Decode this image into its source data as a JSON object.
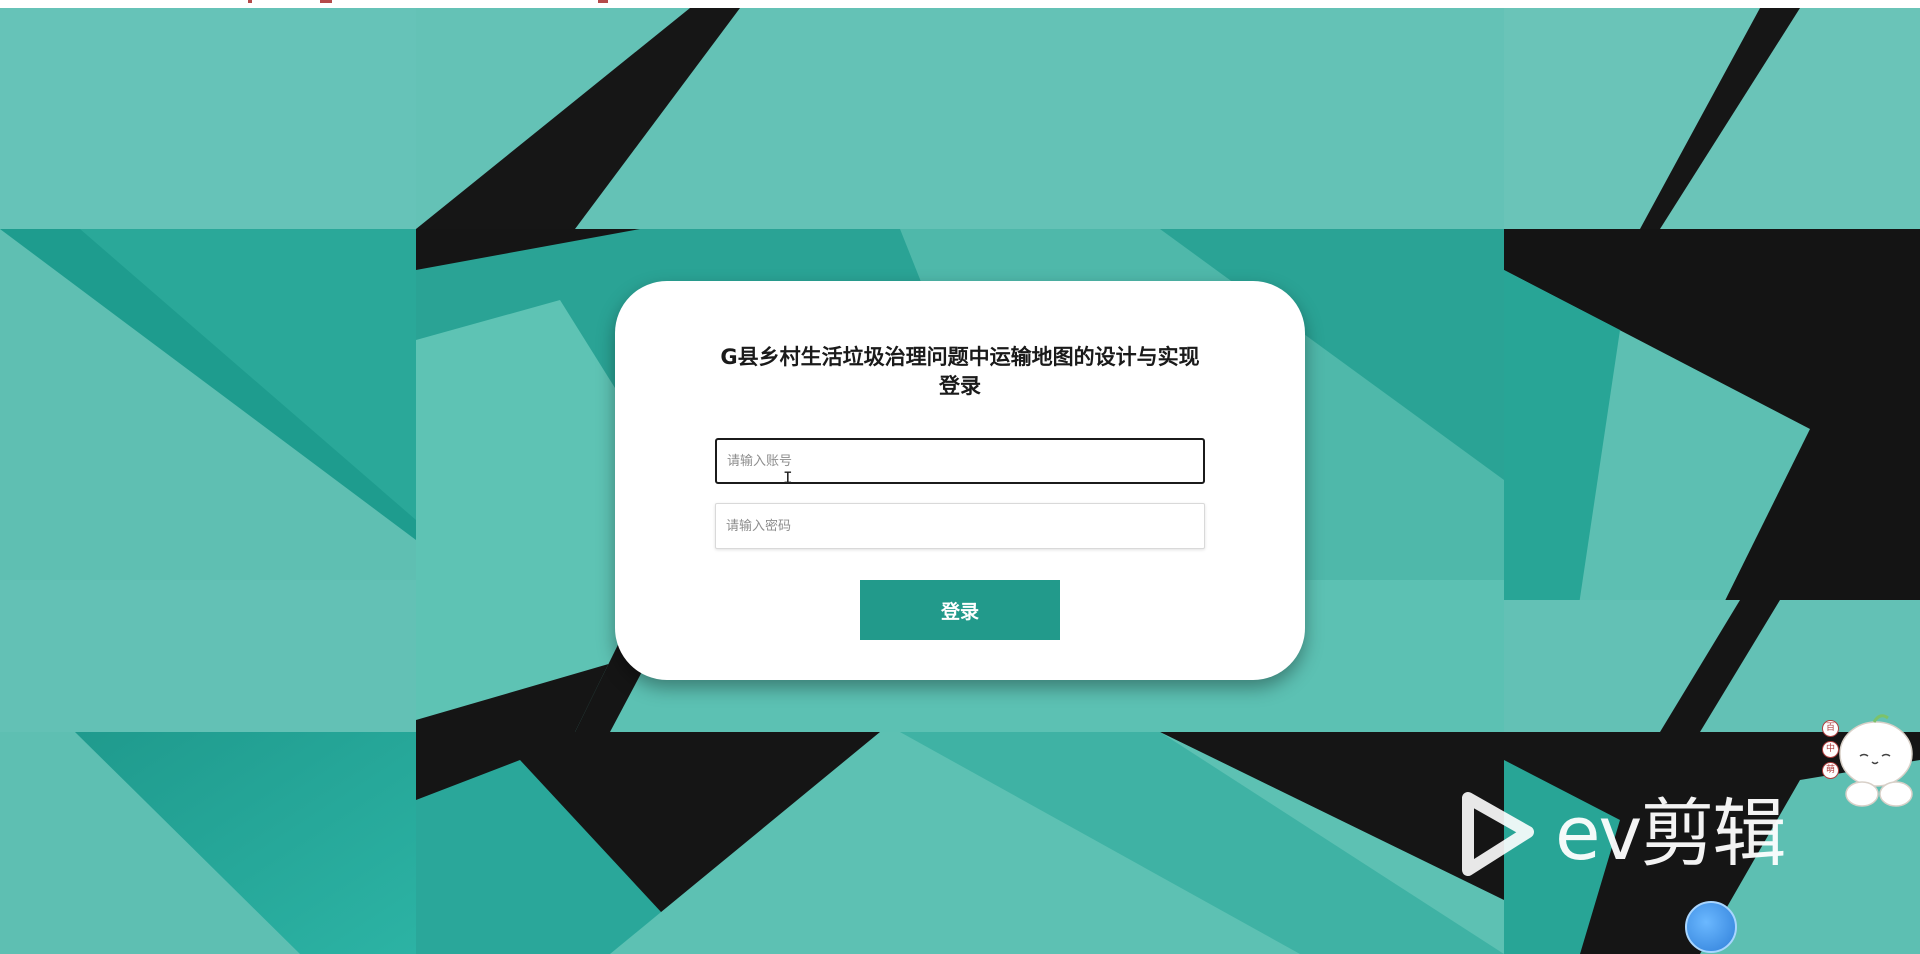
{
  "login": {
    "title": "G县乡村生活垃圾治理问题中运输地图的设计与实现登录",
    "account_placeholder": "请输入账号",
    "password_placeholder": "请输入密码",
    "button_label": "登录"
  },
  "overlay": {
    "watermark_text": "ev剪辑",
    "side_badges": [
      "百",
      "中",
      "萌"
    ]
  },
  "colors": {
    "accent": "#229a8b",
    "background_teal": "#63c0b4",
    "background_dark": "#141414"
  },
  "icons": {
    "watermark": "ev-play-logo-icon",
    "mascot": "mascot-icon",
    "float_ball": "floating-ball-icon"
  }
}
